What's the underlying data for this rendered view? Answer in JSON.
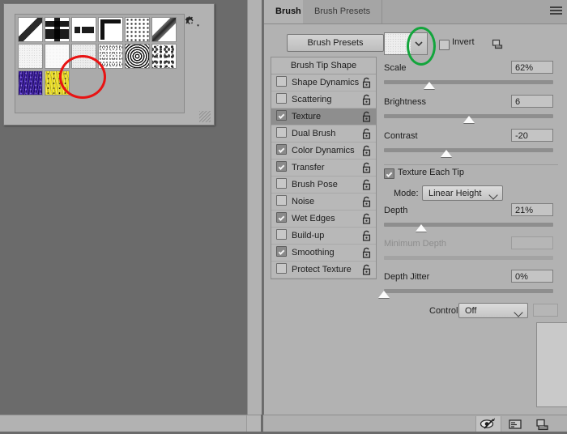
{
  "app": "Adobe Photoshop Brush panel",
  "pattern_picker": {
    "name": "pattern-picker-popup",
    "gear_icon": "gear-icon",
    "grip": "resize-grip",
    "annotation": {
      "shape": "ellipse",
      "color": "#e81313",
      "target": "selected-pattern-swatch"
    },
    "swatches": [
      {
        "name": "diagonal-line-pattern",
        "cls": "p-diag1"
      },
      {
        "name": "vertical-bar-pattern",
        "cls": "p-bar"
      },
      {
        "name": "horizontal-dash-pattern",
        "cls": "p-dash"
      },
      {
        "name": "square-corner-pattern",
        "cls": "p-sq"
      },
      {
        "name": "polka-dot-pattern",
        "cls": "p-dots"
      },
      {
        "name": "thick-diagonal-pattern",
        "cls": "p-diag2"
      },
      {
        "name": "light-noise-pattern",
        "cls": "p-noise-l"
      },
      {
        "name": "white-paper-pattern",
        "cls": "p-noise-w"
      },
      {
        "name": "selected-grain-pattern",
        "cls": "p-noise-sel"
      },
      {
        "name": "fine-grain-pattern",
        "cls": "p-grain"
      },
      {
        "name": "concentric-squares-pattern",
        "cls": "p-rings"
      },
      {
        "name": "clouds-texture-pattern",
        "cls": "p-cloud"
      },
      {
        "name": "blue-fibers-pattern",
        "cls": "p-blue"
      },
      {
        "name": "yellow-fibers-pattern",
        "cls": "p-yellow"
      }
    ]
  },
  "brush_panel": {
    "tabs": [
      {
        "label": "Brush",
        "active": true
      },
      {
        "label": "Brush Presets",
        "active": false
      }
    ],
    "menu_icon": "hamburger-menu-icon",
    "presets_button": "Brush Presets",
    "options_header": "Brush Tip Shape",
    "options": [
      {
        "label": "Shape Dynamics",
        "checked": false,
        "selected": false
      },
      {
        "label": "Scattering",
        "checked": false,
        "selected": false
      },
      {
        "label": "Texture",
        "checked": true,
        "selected": true
      },
      {
        "label": "Dual Brush",
        "checked": false,
        "selected": false
      },
      {
        "label": "Color Dynamics",
        "checked": true,
        "selected": false
      },
      {
        "label": "Transfer",
        "checked": true,
        "selected": false
      },
      {
        "label": "Brush Pose",
        "checked": false,
        "selected": false
      },
      {
        "label": "Noise",
        "checked": false,
        "selected": false
      },
      {
        "label": "Wet Edges",
        "checked": true,
        "selected": false
      },
      {
        "label": "Build-up",
        "checked": false,
        "selected": false
      },
      {
        "label": "Smoothing",
        "checked": true,
        "selected": false
      },
      {
        "label": "Protect Texture",
        "checked": false,
        "selected": false
      }
    ],
    "texture": {
      "thumbnail": "texture-pattern-thumbnail",
      "dropdown_icon": "chevron-down-icon",
      "invert_label": "Invert",
      "invert_checked": false,
      "new_texture_icon": "new-texture-icon",
      "annotation": {
        "shape": "ellipse",
        "color": "#13a53c",
        "target": "texture-dropdown-chevron"
      }
    },
    "sliders": [
      {
        "label": "Scale",
        "value": "62%",
        "pos": 27,
        "disabled": false
      },
      {
        "label": "Brightness",
        "value": "6",
        "pos": 50,
        "disabled": false
      },
      {
        "label": "Contrast",
        "value": "-20",
        "pos": 37,
        "disabled": false
      }
    ],
    "texture_each_tip": {
      "label": "Texture Each Tip",
      "checked": true
    },
    "mode": {
      "label": "Mode:",
      "value": "Linear Height"
    },
    "depth": {
      "label": "Depth",
      "value": "21%",
      "pos": 22
    },
    "minimum_depth": {
      "label": "Minimum Depth",
      "value": "",
      "pos": 0,
      "disabled": true
    },
    "depth_jitter": {
      "label": "Depth Jitter",
      "value": "0%",
      "pos": 0
    },
    "control": {
      "label": "Control:",
      "value": "Off"
    },
    "stroke_preview": "brush-stroke-preview",
    "bottom_icons": [
      {
        "name": "toggle-live-tip-brush-preview-icon",
        "active": true
      },
      {
        "name": "brush-panel-icon",
        "active": false
      },
      {
        "name": "create-new-brush-icon",
        "active": false
      }
    ]
  }
}
